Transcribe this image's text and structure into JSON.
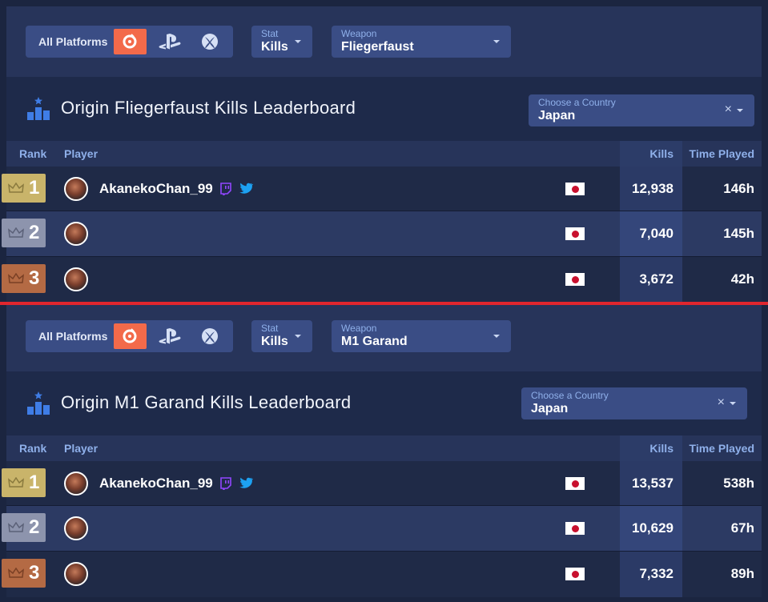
{
  "platforms": {
    "label": "All Platforms",
    "icons": [
      "origin-icon",
      "playstation-icon",
      "xbox-icon"
    ],
    "active": "origin"
  },
  "colors": {
    "accent": "#f36a4a",
    "gold": "#c9b46a",
    "silver": "#8d94ad",
    "bronze": "#b46a44",
    "divider": "#e0262e"
  },
  "columns": {
    "rank": "Rank",
    "player": "Player",
    "kills": "Kills",
    "time_played": "Time Played"
  },
  "boards": [
    {
      "stat_label": "Stat",
      "stat_value": "Kills",
      "weapon_label": "Weapon",
      "weapon_value": "Fliegerfaust",
      "title": "Origin Fliegerfaust Kills Leaderboard",
      "country_label": "Choose a Country",
      "country_value": "Japan",
      "rows": [
        {
          "rank": "1",
          "player": "AkanekoChan_99",
          "kills": "12,938",
          "time": "146h"
        },
        {
          "rank": "2",
          "player": "",
          "kills": "7,040",
          "time": "145h"
        },
        {
          "rank": "3",
          "player": "",
          "kills": "3,672",
          "time": "42h"
        }
      ]
    },
    {
      "stat_label": "Stat",
      "stat_value": "Kills",
      "weapon_label": "Weapon",
      "weapon_value": "M1 Garand",
      "title": "Origin M1 Garand Kills Leaderboard",
      "country_label": "Choose a Country",
      "country_value": "Japan",
      "rows": [
        {
          "rank": "1",
          "player": "AkanekoChan_99",
          "kills": "13,537",
          "time": "538h"
        },
        {
          "rank": "2",
          "player": "",
          "kills": "10,629",
          "time": "67h"
        },
        {
          "rank": "3",
          "player": "",
          "kills": "7,332",
          "time": "89h"
        }
      ]
    }
  ]
}
